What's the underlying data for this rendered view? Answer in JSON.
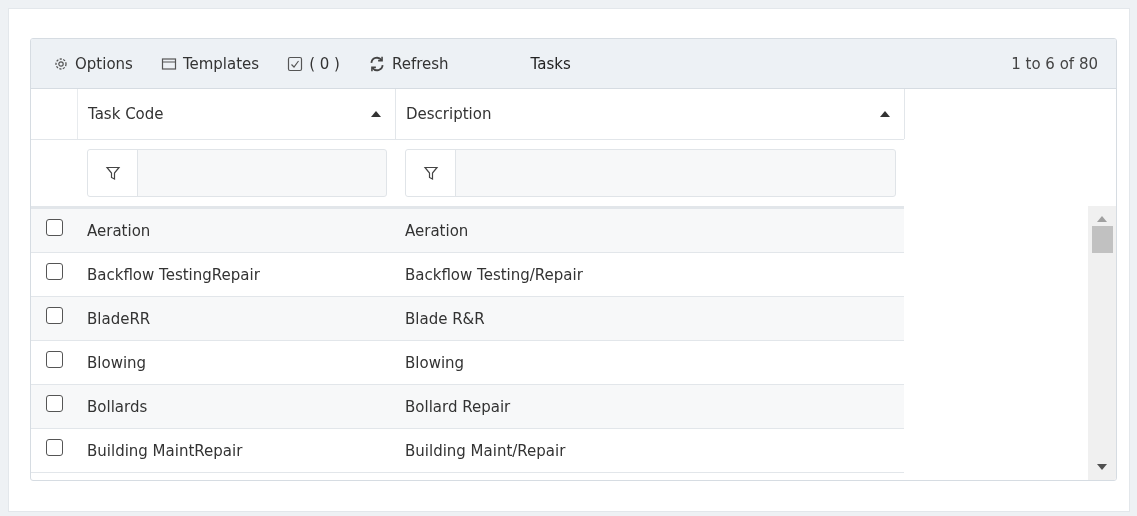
{
  "toolbar": {
    "buttons": [
      {
        "kind": "options",
        "label": "Options"
      },
      {
        "kind": "templates",
        "label": "Templates"
      },
      {
        "kind": "selection",
        "label": "( 0 )"
      },
      {
        "kind": "refresh",
        "label": "Refresh"
      }
    ],
    "title": "Tasks",
    "paging": "1 to 6 of 80"
  },
  "table": {
    "columns": [
      {
        "label": "Task Code",
        "sorted": true
      },
      {
        "label": "Description",
        "sorted": true
      }
    ],
    "rows": [
      {
        "checked": false,
        "cells": [
          "Aeration",
          "Aeration"
        ]
      },
      {
        "checked": false,
        "cells": [
          "Backflow TestingRepair",
          "Backflow Testing/Repair"
        ]
      },
      {
        "checked": false,
        "cells": [
          "BladeRR",
          "Blade R&R"
        ]
      },
      {
        "checked": false,
        "cells": [
          "Blowing",
          "Blowing"
        ]
      },
      {
        "checked": false,
        "cells": [
          "Bollards",
          "Bollard Repair"
        ]
      },
      {
        "checked": false,
        "cells": [
          "Building MaintRepair",
          "Building Maint/Repair"
        ]
      }
    ]
  }
}
